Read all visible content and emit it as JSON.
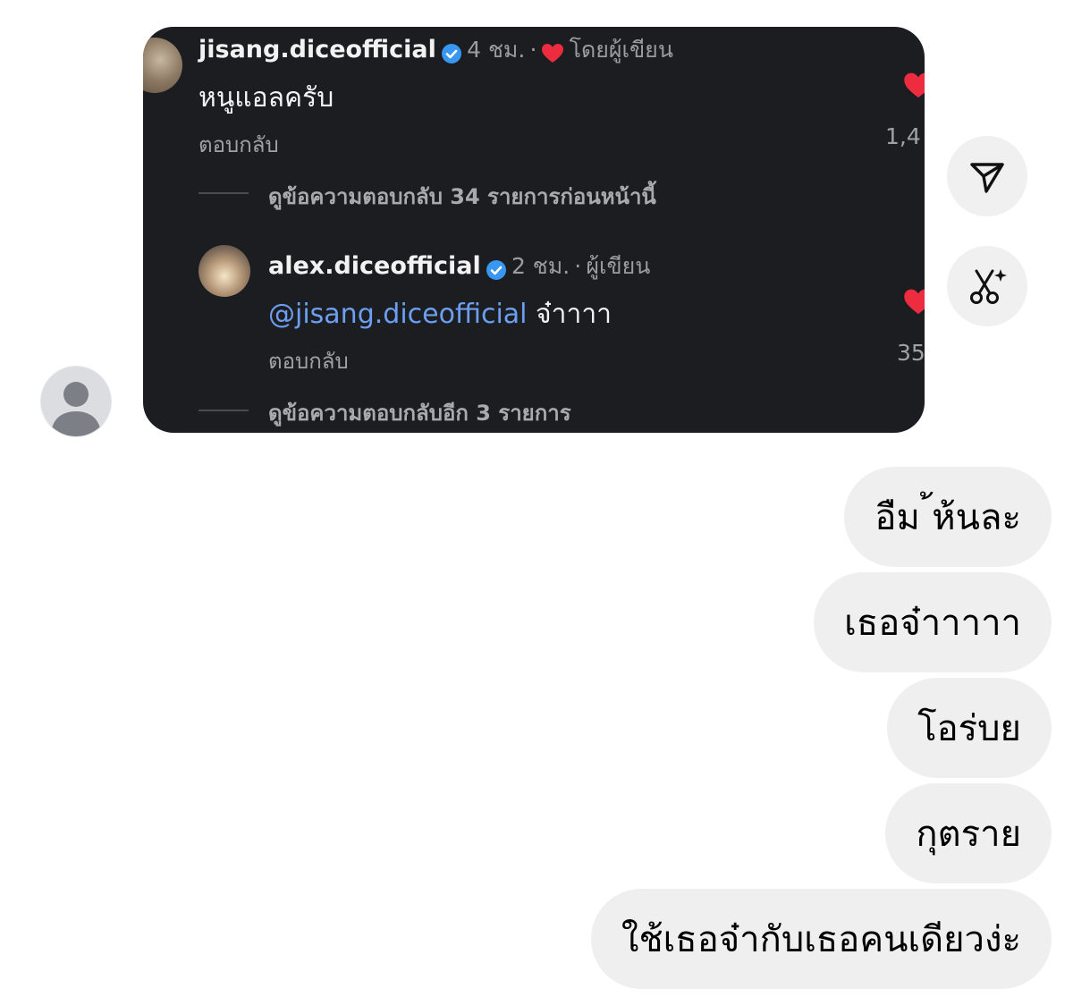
{
  "shared_post": {
    "comment1": {
      "username": "jisang.diceofficial",
      "time": "4 ชม.",
      "separator": "·",
      "liked_by_author": "โดยผู้เขียน",
      "text": "หนูแอลครับ",
      "reply_label": "ตอบกลับ",
      "like_count": "1,4",
      "view_replies": "ดูข้อความตอบกลับ 34 รายการก่อนหน้านี้"
    },
    "comment2": {
      "username": "alex.diceofficial",
      "time": "2 ชม.",
      "separator": "·",
      "author_label": "ผู้เขียน",
      "mention": "@jisang.diceofficial",
      "text": " จ๋าาาา",
      "reply_label": "ตอบกลับ",
      "like_count": "35",
      "view_more_replies": "ดูข้อความตอบกลับอีก 3 รายการ"
    },
    "colors": {
      "card_bg": "#1c1d20",
      "mention": "#6c9ff2",
      "verified": "#3897f0",
      "heart": "#ed2c3f"
    }
  },
  "actions": {
    "share_icon": "send-icon",
    "ai_edit_icon": "scissors-sparkle-icon"
  },
  "messages": [
    {
      "text": "อืม ้ห้นละ"
    },
    {
      "text": "เธอจ๋าาาาา"
    },
    {
      "text": "โอร่บย"
    },
    {
      "text": "กุตราย"
    },
    {
      "text": "ใช้เธอจ๋ากับเธอคนเดียวง่ะ"
    }
  ],
  "bubble_color": "#efefef"
}
